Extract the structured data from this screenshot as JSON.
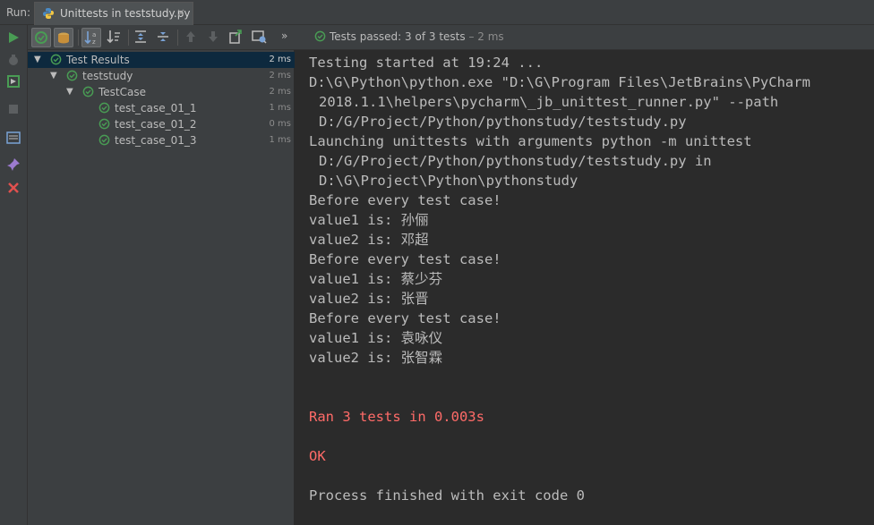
{
  "header": {
    "run_label": "Run:",
    "tab_title": "Unittests in teststudy.py",
    "tab_close": "×"
  },
  "toolbar": {
    "status_prefix": "Tests passed:",
    "status_count": "3 of 3 tests",
    "status_time": "– 2 ms",
    "overflow": "»"
  },
  "tree": {
    "rows": [
      {
        "label": "Test Results",
        "duration": "2 ms"
      },
      {
        "label": "teststudy",
        "duration": "2 ms"
      },
      {
        "label": "TestCase",
        "duration": "2 ms"
      },
      {
        "label": "test_case_01_1",
        "duration": "1 ms"
      },
      {
        "label": "test_case_01_2",
        "duration": "0 ms"
      },
      {
        "label": "test_case_01_3",
        "duration": "1 ms"
      }
    ]
  },
  "console": {
    "lines": [
      "Testing started at 19:24 ...",
      "D:\\G\\Python\\python.exe \"D:\\G\\Program Files\\JetBrains\\PyCharm",
      "2018.1.1\\helpers\\pycharm\\_jb_unittest_runner.py\" --path",
      "D:/G/Project/Python/pythonstudy/teststudy.py",
      "Launching unittests with arguments python -m unittest",
      "D:/G/Project/Python/pythonstudy/teststudy.py in",
      "D:\\G\\Project\\Python\\pythonstudy",
      "Before every test case!",
      "value1 is: 孙俪",
      "value2 is: 邓超",
      "Before every test case!",
      "value1 is: 蔡少芬",
      "value2 is: 张晋",
      "Before every test case!",
      "value1 is: 袁咏仪",
      "value2 is: 张智霖",
      "Ran 3 tests in 0.003s",
      "OK",
      "Process finished with exit code 0"
    ]
  },
  "colors": {
    "pass_green": "#499c54",
    "error_red": "#ff6b68",
    "selection": "#0d293e"
  },
  "icons": [
    "python-file-icon",
    "run-icon",
    "debug-icon",
    "rerun-failed-icon",
    "stop-icon",
    "layout-icon",
    "pin-icon",
    "close-icon",
    "show-passed-icon",
    "show-ignored-icon",
    "sort-alpha-icon",
    "sort-duration-icon",
    "expand-all-icon",
    "collapse-all-icon",
    "prev-failed-icon",
    "next-failed-icon",
    "export-icon",
    "import-icon",
    "check-circle-icon"
  ]
}
